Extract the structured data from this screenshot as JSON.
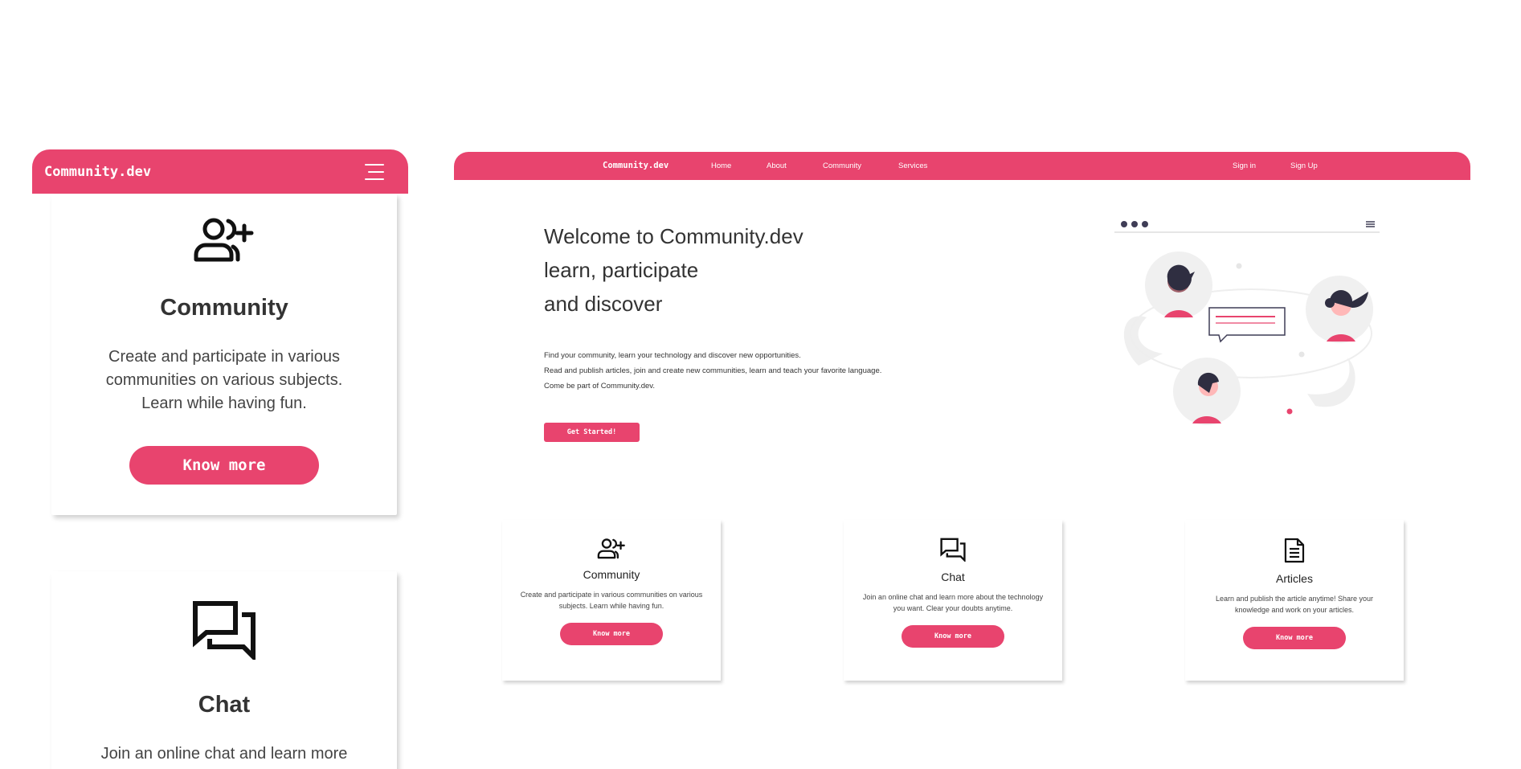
{
  "colors": {
    "accent": "#e8446e",
    "icon": "#111111"
  },
  "mobile": {
    "logo": "Community.dev",
    "menu_icon": "hamburger-icon",
    "cards": [
      {
        "icon": "add-user-icon",
        "title": "Community",
        "desc_lines": [
          "Create and participate in various",
          "communities on various subjects.",
          "Learn while having fun."
        ],
        "button": "Know more"
      },
      {
        "icon": "chat-icon",
        "title": "Chat",
        "desc_lines": [
          "Join an online chat and learn more"
        ]
      }
    ]
  },
  "desktop": {
    "nav": {
      "logo": "Community.dev",
      "links": [
        "Home",
        "About",
        "Community",
        "Services"
      ],
      "sign_in": "Sign in",
      "sign_up": "Sign Up"
    },
    "hero": {
      "title_lines": [
        "Welcome to Community.dev",
        "learn, participate",
        "and discover"
      ],
      "text_lines": [
        "Find your community, learn your technology and discover new opportunities.",
        "Read and publish articles, join and create new communities, learn and teach your favorite language.",
        "Come be part of Community.dev."
      ],
      "button": "Get Started!"
    },
    "cards": [
      {
        "icon": "add-user-icon",
        "title": "Community",
        "desc_lines": [
          "Create and participate in various communities on various",
          "subjects. Learn while having fun."
        ],
        "button": "Know more"
      },
      {
        "icon": "chat-icon",
        "title": "Chat",
        "desc_lines": [
          "Join an online chat and learn more about the technology",
          "you want. Clear your doubts anytime."
        ],
        "button": "Know more"
      },
      {
        "icon": "document-icon",
        "title": "Articles",
        "desc_lines": [
          "Learn and publish the article anytime! Share your",
          "knowledge and work on your articles."
        ],
        "button": "Know more"
      }
    ]
  }
}
